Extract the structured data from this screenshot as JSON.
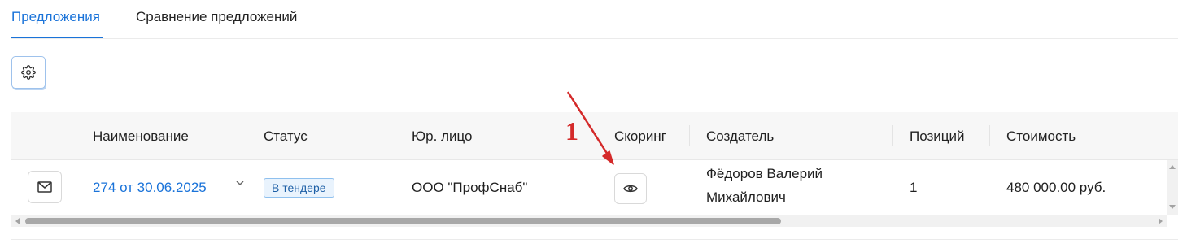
{
  "tabs": [
    {
      "label": "Предложения",
      "active": true
    },
    {
      "label": "Сравнение предложений",
      "active": false
    }
  ],
  "toolbar": {
    "settings_icon": "gear-icon"
  },
  "table": {
    "headers": {
      "name": "Наименование",
      "status": "Статус",
      "legal": "Юр. лицо",
      "scoring": "Скоринг",
      "creator": "Создатель",
      "positions": "Позиций",
      "cost": "Стоимость"
    },
    "rows": [
      {
        "name": "274 от 30.06.2025",
        "status": "В тендере",
        "legal": "ООО \"ПрофСнаб\"",
        "creator_line1": "Фёдоров Валерий",
        "creator_line2": "Михайлович",
        "positions": "1",
        "cost": "480 000.00 руб."
      }
    ]
  },
  "annotation": {
    "label": "1",
    "color": "#d42a2a"
  },
  "colors": {
    "accent": "#1a73d9",
    "badge_bg": "#e9f3fd",
    "badge_border": "#8fc0ee"
  }
}
